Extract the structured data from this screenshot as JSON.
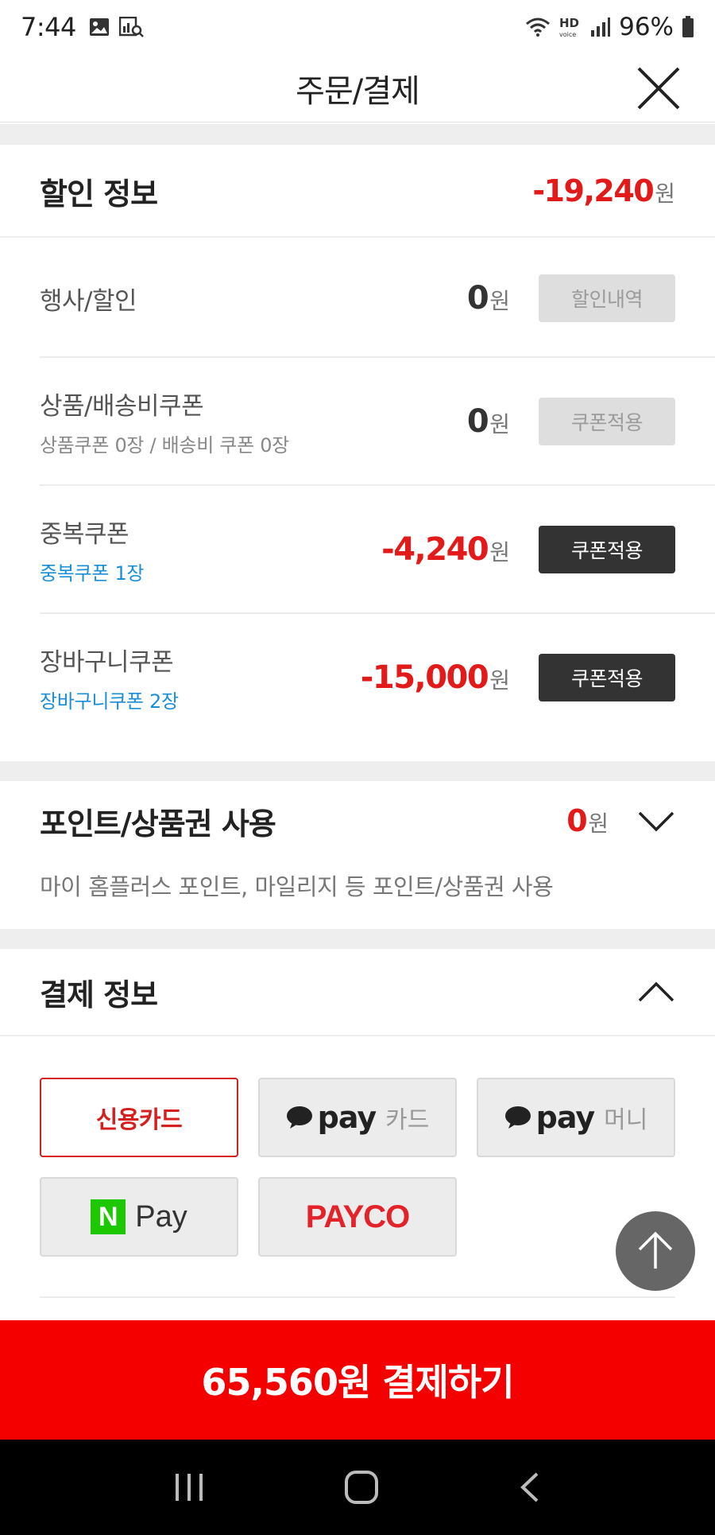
{
  "status_bar": {
    "time": "7:44",
    "battery": "96%",
    "icons": [
      "image-icon",
      "chart-search-icon",
      "wifi-icon",
      "hd-voice-icon",
      "signal-icon",
      "battery-icon"
    ]
  },
  "header": {
    "title": "주문/결제",
    "close_icon": "close-icon"
  },
  "discount": {
    "title": "할인 정보",
    "total": "-19,240",
    "unit": "원",
    "rows": [
      {
        "label": "행사/할인",
        "sub": "",
        "amount": "0",
        "unit": "원",
        "button": "할인내역",
        "button_state": "disabled"
      },
      {
        "label": "상품/배송비쿠폰",
        "sub": "상품쿠폰 0장 / 배송비 쿠폰 0장",
        "amount": "0",
        "unit": "원",
        "button": "쿠폰적용",
        "button_state": "disabled"
      },
      {
        "label": "중복쿠폰",
        "sub": "중복쿠폰 1장",
        "amount": "-4,240",
        "unit": "원",
        "button": "쿠폰적용",
        "button_state": "active"
      },
      {
        "label": "장바구니쿠폰",
        "sub": "장바구니쿠폰 2장",
        "amount": "-15,000",
        "unit": "원",
        "button": "쿠폰적용",
        "button_state": "active"
      }
    ]
  },
  "points": {
    "title": "포인트/상품권 사용",
    "amount": "0",
    "unit": "원",
    "description": "마이 홈플러스 포인트, 마일리지 등 포인트/상품권 사용",
    "expanded": false
  },
  "payment": {
    "title": "결제 정보",
    "expanded": true,
    "methods": {
      "credit_card": "신용카드",
      "kakao_card_pay": "pay",
      "kakao_card_sub": "카드",
      "kakao_money_pay": "pay",
      "kakao_money_sub": "머니",
      "npay_logo": "N",
      "npay_text": "Pay",
      "payco": "PAYCO"
    },
    "selected": "credit_card"
  },
  "pay_button": {
    "label": "65,560원 결제하기"
  },
  "colors": {
    "accent_red": "#e21a1a",
    "pay_bar": "#f40000",
    "link_blue": "#1a8fd8",
    "npay_green": "#1ec800"
  }
}
